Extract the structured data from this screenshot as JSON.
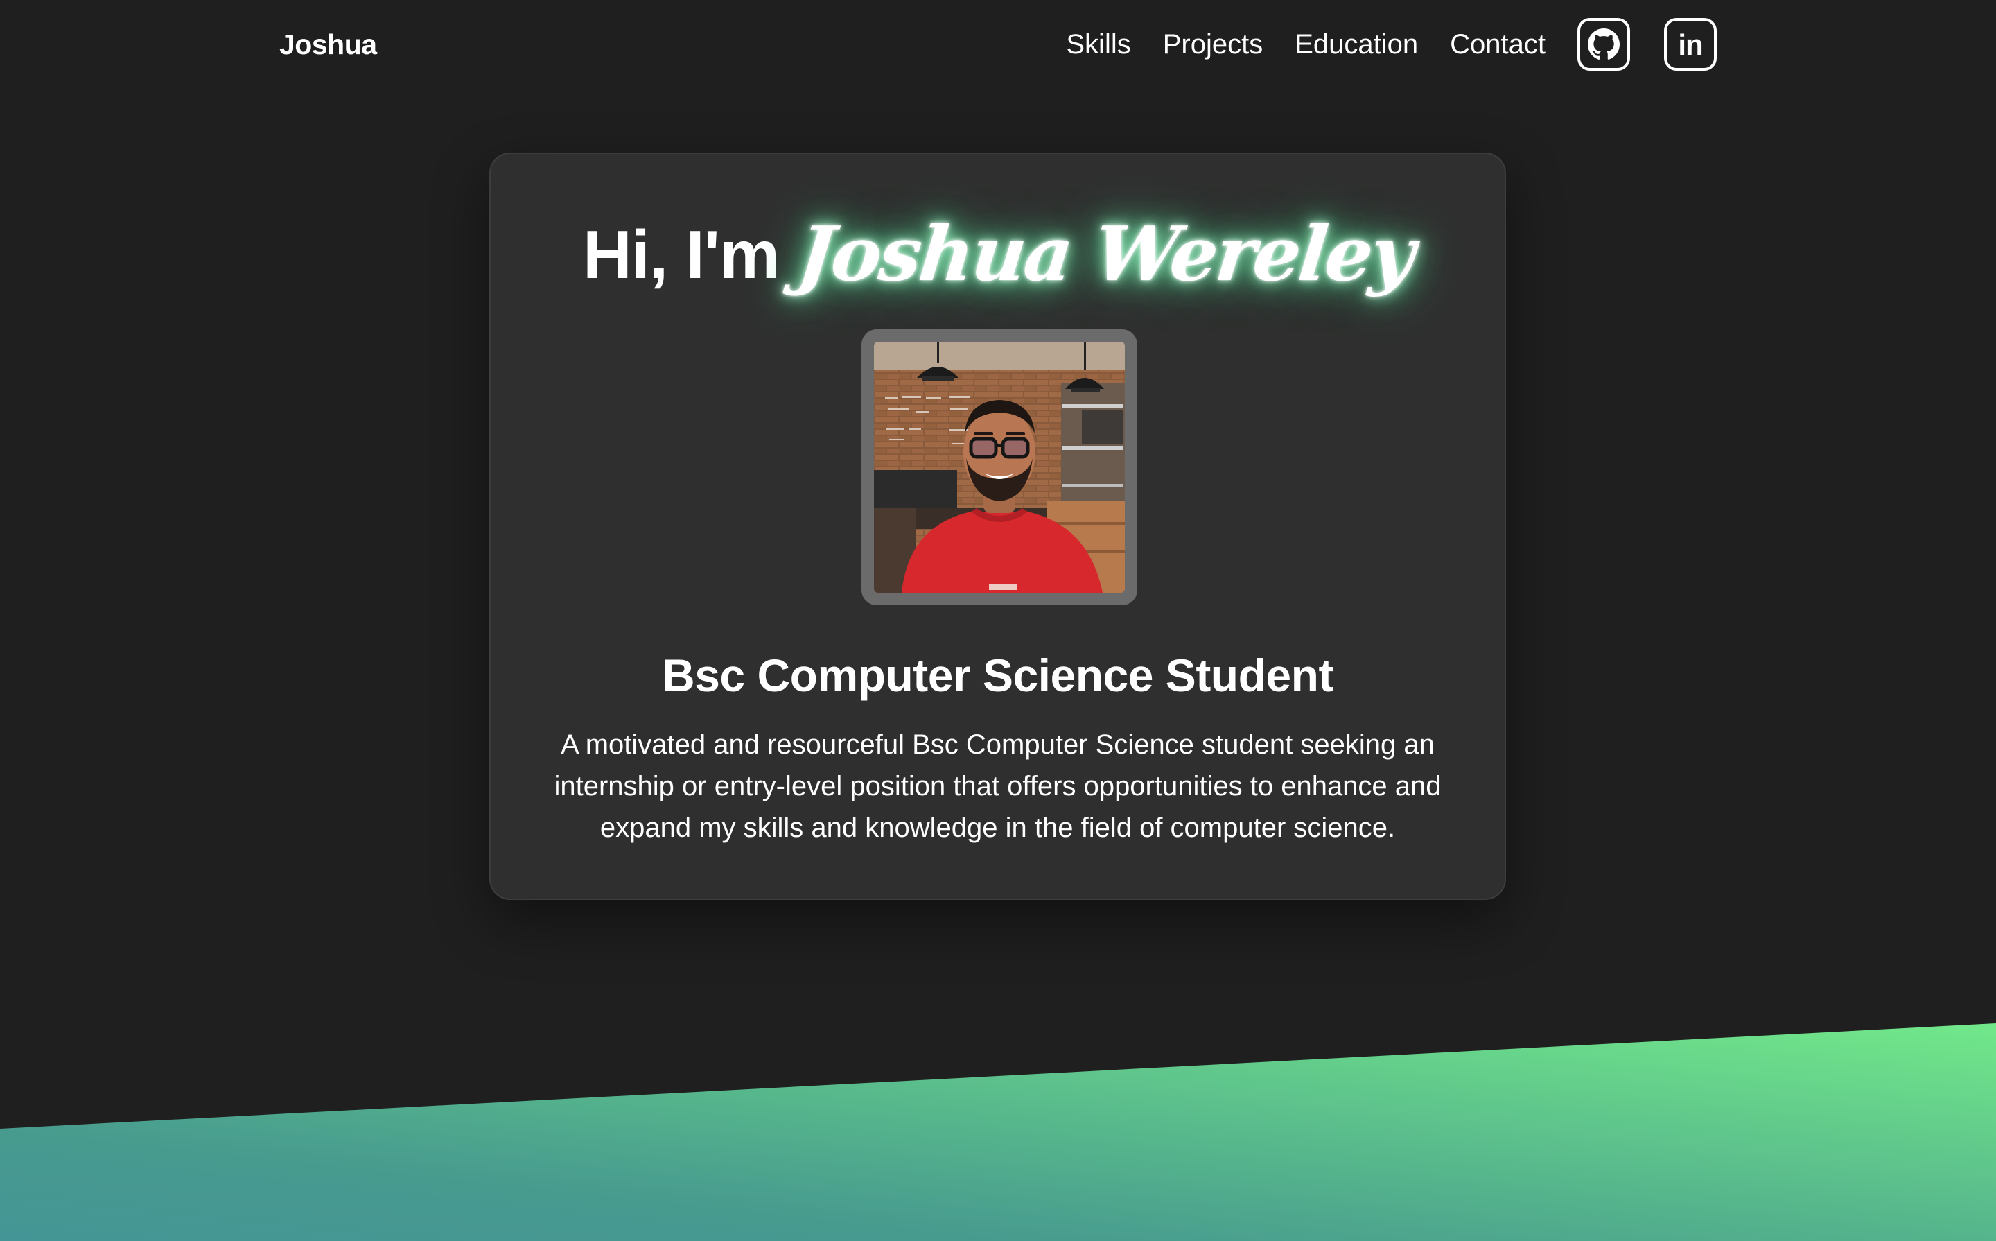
{
  "nav": {
    "brand": "Joshua",
    "links": [
      {
        "label": "Skills"
      },
      {
        "label": "Projects"
      },
      {
        "label": "Education"
      },
      {
        "label": "Contact"
      }
    ],
    "social": [
      {
        "icon": "github-icon"
      },
      {
        "icon": "linkedin-icon",
        "text": "in"
      }
    ]
  },
  "hero": {
    "greeting": "Hi, I'm",
    "name": "Joshua Wereley",
    "subtitle": "Bsc Computer Science Student",
    "bio": "A motivated and resourceful Bsc Computer Science student seeking an internship or entry-level position that offers opportunities to enhance and expand my skills and knowledge in the field of computer science."
  },
  "colors": {
    "background": "#1f1f1f",
    "card": "#2f2f2f",
    "glow": "#5edc9a",
    "gradient_start": "#449696",
    "gradient_end": "#70e58a"
  }
}
